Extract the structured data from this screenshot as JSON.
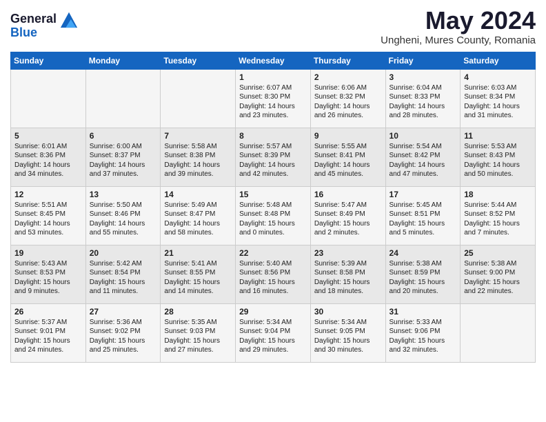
{
  "logo": {
    "general": "General",
    "blue": "Blue"
  },
  "title": "May 2024",
  "subtitle": "Ungheni, Mures County, Romania",
  "headers": [
    "Sunday",
    "Monday",
    "Tuesday",
    "Wednesday",
    "Thursday",
    "Friday",
    "Saturday"
  ],
  "weeks": [
    [
      {
        "day": "",
        "info": ""
      },
      {
        "day": "",
        "info": ""
      },
      {
        "day": "",
        "info": ""
      },
      {
        "day": "1",
        "info": "Sunrise: 6:07 AM\nSunset: 8:30 PM\nDaylight: 14 hours\nand 23 minutes."
      },
      {
        "day": "2",
        "info": "Sunrise: 6:06 AM\nSunset: 8:32 PM\nDaylight: 14 hours\nand 26 minutes."
      },
      {
        "day": "3",
        "info": "Sunrise: 6:04 AM\nSunset: 8:33 PM\nDaylight: 14 hours\nand 28 minutes."
      },
      {
        "day": "4",
        "info": "Sunrise: 6:03 AM\nSunset: 8:34 PM\nDaylight: 14 hours\nand 31 minutes."
      }
    ],
    [
      {
        "day": "5",
        "info": "Sunrise: 6:01 AM\nSunset: 8:36 PM\nDaylight: 14 hours\nand 34 minutes."
      },
      {
        "day": "6",
        "info": "Sunrise: 6:00 AM\nSunset: 8:37 PM\nDaylight: 14 hours\nand 37 minutes."
      },
      {
        "day": "7",
        "info": "Sunrise: 5:58 AM\nSunset: 8:38 PM\nDaylight: 14 hours\nand 39 minutes."
      },
      {
        "day": "8",
        "info": "Sunrise: 5:57 AM\nSunset: 8:39 PM\nDaylight: 14 hours\nand 42 minutes."
      },
      {
        "day": "9",
        "info": "Sunrise: 5:55 AM\nSunset: 8:41 PM\nDaylight: 14 hours\nand 45 minutes."
      },
      {
        "day": "10",
        "info": "Sunrise: 5:54 AM\nSunset: 8:42 PM\nDaylight: 14 hours\nand 47 minutes."
      },
      {
        "day": "11",
        "info": "Sunrise: 5:53 AM\nSunset: 8:43 PM\nDaylight: 14 hours\nand 50 minutes."
      }
    ],
    [
      {
        "day": "12",
        "info": "Sunrise: 5:51 AM\nSunset: 8:45 PM\nDaylight: 14 hours\nand 53 minutes."
      },
      {
        "day": "13",
        "info": "Sunrise: 5:50 AM\nSunset: 8:46 PM\nDaylight: 14 hours\nand 55 minutes."
      },
      {
        "day": "14",
        "info": "Sunrise: 5:49 AM\nSunset: 8:47 PM\nDaylight: 14 hours\nand 58 minutes."
      },
      {
        "day": "15",
        "info": "Sunrise: 5:48 AM\nSunset: 8:48 PM\nDaylight: 15 hours\nand 0 minutes."
      },
      {
        "day": "16",
        "info": "Sunrise: 5:47 AM\nSunset: 8:49 PM\nDaylight: 15 hours\nand 2 minutes."
      },
      {
        "day": "17",
        "info": "Sunrise: 5:45 AM\nSunset: 8:51 PM\nDaylight: 15 hours\nand 5 minutes."
      },
      {
        "day": "18",
        "info": "Sunrise: 5:44 AM\nSunset: 8:52 PM\nDaylight: 15 hours\nand 7 minutes."
      }
    ],
    [
      {
        "day": "19",
        "info": "Sunrise: 5:43 AM\nSunset: 8:53 PM\nDaylight: 15 hours\nand 9 minutes."
      },
      {
        "day": "20",
        "info": "Sunrise: 5:42 AM\nSunset: 8:54 PM\nDaylight: 15 hours\nand 11 minutes."
      },
      {
        "day": "21",
        "info": "Sunrise: 5:41 AM\nSunset: 8:55 PM\nDaylight: 15 hours\nand 14 minutes."
      },
      {
        "day": "22",
        "info": "Sunrise: 5:40 AM\nSunset: 8:56 PM\nDaylight: 15 hours\nand 16 minutes."
      },
      {
        "day": "23",
        "info": "Sunrise: 5:39 AM\nSunset: 8:58 PM\nDaylight: 15 hours\nand 18 minutes."
      },
      {
        "day": "24",
        "info": "Sunrise: 5:38 AM\nSunset: 8:59 PM\nDaylight: 15 hours\nand 20 minutes."
      },
      {
        "day": "25",
        "info": "Sunrise: 5:38 AM\nSunset: 9:00 PM\nDaylight: 15 hours\nand 22 minutes."
      }
    ],
    [
      {
        "day": "26",
        "info": "Sunrise: 5:37 AM\nSunset: 9:01 PM\nDaylight: 15 hours\nand 24 minutes."
      },
      {
        "day": "27",
        "info": "Sunrise: 5:36 AM\nSunset: 9:02 PM\nDaylight: 15 hours\nand 25 minutes."
      },
      {
        "day": "28",
        "info": "Sunrise: 5:35 AM\nSunset: 9:03 PM\nDaylight: 15 hours\nand 27 minutes."
      },
      {
        "day": "29",
        "info": "Sunrise: 5:34 AM\nSunset: 9:04 PM\nDaylight: 15 hours\nand 29 minutes."
      },
      {
        "day": "30",
        "info": "Sunrise: 5:34 AM\nSunset: 9:05 PM\nDaylight: 15 hours\nand 30 minutes."
      },
      {
        "day": "31",
        "info": "Sunrise: 5:33 AM\nSunset: 9:06 PM\nDaylight: 15 hours\nand 32 minutes."
      },
      {
        "day": "",
        "info": ""
      }
    ]
  ]
}
